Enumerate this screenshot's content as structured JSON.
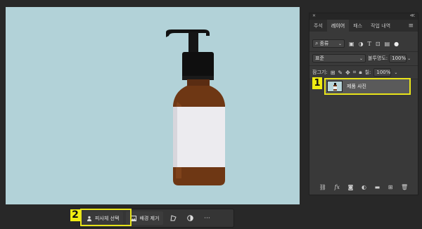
{
  "taskbar": {
    "select_subject_label": "피사체 선택",
    "remove_bg_label": "배경 제거",
    "more_label": "···"
  },
  "badges": {
    "one": "1",
    "two": "2"
  },
  "layers_panel": {
    "tabs": [
      "주석",
      "레이어",
      "패스",
      "작업 내역"
    ],
    "active_tab": "레이어",
    "collapse_label": "≪",
    "kind_filter_label": "종류",
    "blend_mode": "표준",
    "opacity_label": "불투명도:",
    "opacity_value": "100%",
    "lock_label": "잠그기:",
    "fill_label": "칠:",
    "fill_value": "100%",
    "layer_name": "제품 사진"
  },
  "colors": {
    "canvas_bg": "#b2d2d8",
    "highlight": "#e8e41a"
  }
}
